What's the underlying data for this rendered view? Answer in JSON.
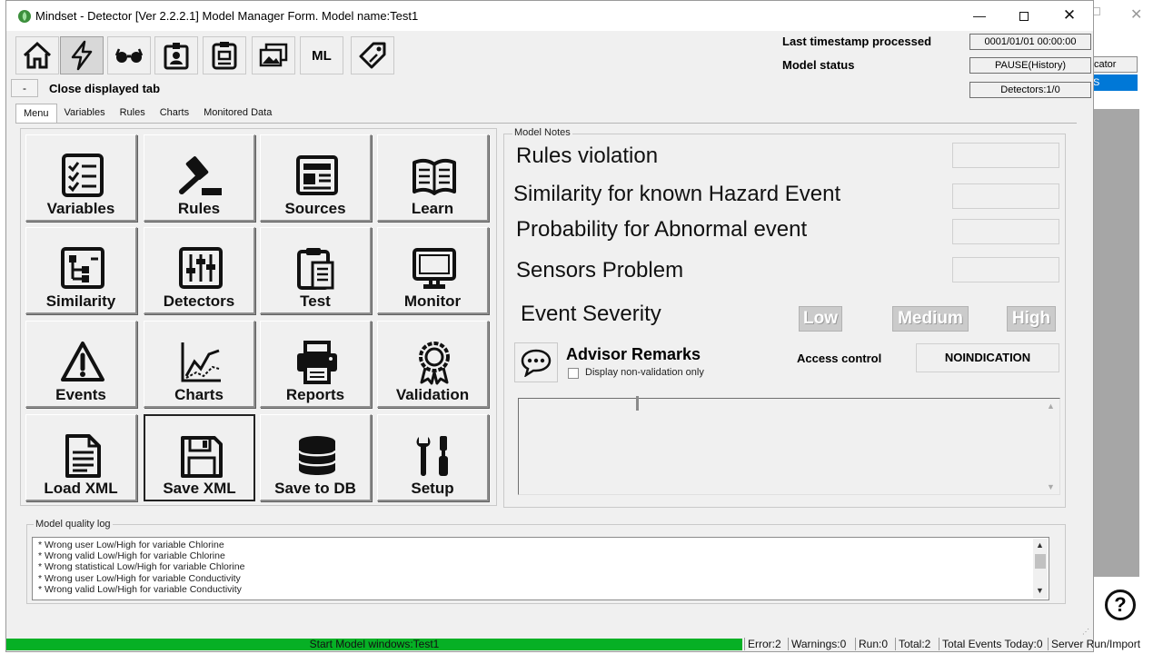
{
  "window": {
    "title": "Mindset - Detector [Ver 2.2.2.1] Model Manager Form.  Model name:Test1"
  },
  "toolbar": {
    "buttons": [
      {
        "icon": "home-icon"
      },
      {
        "icon": "lightning-icon"
      },
      {
        "icon": "glasses-icon"
      },
      {
        "icon": "badge-icon"
      },
      {
        "icon": "id-card-icon"
      },
      {
        "icon": "images-icon"
      },
      {
        "icon": "ml-icon",
        "label": "ML"
      },
      {
        "icon": "tags-icon"
      }
    ]
  },
  "close_tab": {
    "button_label": "-",
    "label": "Close displayed tab"
  },
  "tabs": [
    "Menu",
    "Variables",
    "Rules",
    "Charts",
    "Monitored Data"
  ],
  "status": {
    "last_timestamp_label": "Last timestamp processed",
    "last_timestamp_value": "0001/01/01 00:00:00",
    "model_status_label": "Model status",
    "model_status_value": "PAUSE(History)",
    "detectors_value": "Detectors:1/0"
  },
  "menu_buttons": [
    {
      "label": "Variables",
      "icon": "checklist-icon"
    },
    {
      "label": "Rules",
      "icon": "gavel-icon"
    },
    {
      "label": "Sources",
      "icon": "newspaper-icon"
    },
    {
      "label": "Learn",
      "icon": "book-icon"
    },
    {
      "label": "Similarity",
      "icon": "similarity-icon"
    },
    {
      "label": "Detectors",
      "icon": "sliders-icon"
    },
    {
      "label": "Test",
      "icon": "clipboard-icon"
    },
    {
      "label": "Monitor",
      "icon": "monitor-icon"
    },
    {
      "label": "Events",
      "icon": "warning-icon"
    },
    {
      "label": "Charts",
      "icon": "line-chart-icon"
    },
    {
      "label": "Reports",
      "icon": "printer-icon"
    },
    {
      "label": "Validation",
      "icon": "award-icon"
    },
    {
      "label": "Load XML",
      "icon": "document-icon"
    },
    {
      "label": "Save XML",
      "icon": "floppy-icon"
    },
    {
      "label": "Save to DB",
      "icon": "database-icon"
    },
    {
      "label": "Setup",
      "icon": "tools-icon"
    }
  ],
  "notes": {
    "legend": "Model Notes",
    "rules_violation": "Rules violation",
    "similarity_hazard": "Similarity for known Hazard Event",
    "probability_abnormal": "Probability for Abnormal event",
    "sensors_problem": "Sensors Problem",
    "event_severity": "Event Severity",
    "severity_low": "Low",
    "severity_medium": "Medium",
    "severity_high": "High",
    "advisor_title": "Advisor Remarks",
    "display_non_validation": "Display non-validation only",
    "access_control_label": "Access control",
    "access_control_value": "NOINDICATION"
  },
  "quality_log": {
    "legend": "Model quality log",
    "items": [
      "* Wrong user Low/High for variable Chlorine",
      "* Wrong valid Low/High for variable Chlorine",
      "* Wrong statistical Low/High for variable Chlorine",
      "* Wrong user Low/High for variable Conductivity",
      "* Wrong valid Low/High for variable Conductivity"
    ]
  },
  "statusbar": {
    "progress_text": "Start Model windows:Test1",
    "error": "Error:2",
    "warnings": "Warnings:0",
    "run": "Run:0",
    "total": "Total:2",
    "total_events_today": "Total Events Today:0",
    "server_run": "Server Run/Import"
  },
  "background_window": {
    "dropdown_text": "cator",
    "selected_text": "S",
    "help_label": "?"
  },
  "colors": {
    "window_bg": "#f0f0f0",
    "progress_green": "#06b025",
    "selection_blue": "#0078d7"
  }
}
